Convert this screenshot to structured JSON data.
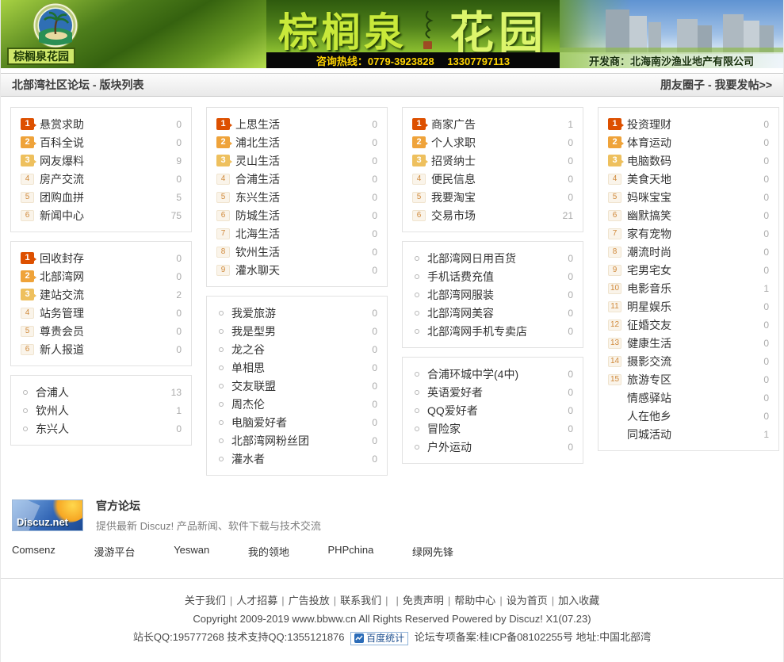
{
  "colors": {
    "banner_green_dark": "#2e5a0e",
    "banner_green_light": "#b8e34c",
    "rank1": "#dd5000",
    "rank2": "#efa33a",
    "rank3": "#eec05e",
    "rank_other_text": "#d08a3c",
    "count_gray": "#aaaaaa",
    "hotline_yellow": "#ffd400",
    "discuz_blue": "#2f64b4",
    "flame_orange": "#f6a623"
  },
  "banner": {
    "logo_label": "棕榈泉花园",
    "title_part1": "棕榈泉",
    "title_part2": "花园",
    "hotline": "咨询热线：0779-3923828　 13307797113",
    "developer": "开发商：北海南沙渔业地产有限公司"
  },
  "header": {
    "title": "北部湾社区论坛 - 版块列表",
    "right_links": [
      {
        "label": "朋友圈子"
      },
      {
        "label": "我要发帖>>"
      }
    ],
    "right_separator": " - "
  },
  "columns": [
    {
      "boxes": [
        {
          "items": [
            {
              "rank": "1",
              "label": "悬赏求助",
              "count": "0"
            },
            {
              "rank": "2",
              "label": "百科全说",
              "count": "0"
            },
            {
              "rank": "3",
              "label": "网友爆料",
              "count": "9"
            },
            {
              "rank": "4",
              "label": "房产交流",
              "count": "0"
            },
            {
              "rank": "5",
              "label": "团购血拼",
              "count": "5"
            },
            {
              "rank": "6",
              "label": "新闻中心",
              "count": "75"
            }
          ]
        },
        {
          "items": [
            {
              "rank": "1",
              "label": "回收封存",
              "count": "0"
            },
            {
              "rank": "2",
              "label": "北部湾网",
              "count": "0"
            },
            {
              "rank": "3",
              "label": "建站交流",
              "count": "2"
            },
            {
              "rank": "4",
              "label": "站务管理",
              "count": "0"
            },
            {
              "rank": "5",
              "label": "尊贵会员",
              "count": "0"
            },
            {
              "rank": "6",
              "label": "新人报道",
              "count": "0"
            }
          ]
        },
        {
          "items": [
            {
              "bullet": true,
              "label": "合浦人",
              "count": "13"
            },
            {
              "bullet": true,
              "label": "钦州人",
              "count": "1"
            },
            {
              "bullet": true,
              "label": "东兴人",
              "count": "0"
            }
          ]
        }
      ]
    },
    {
      "boxes": [
        {
          "items": [
            {
              "rank": "1",
              "label": "上思生活",
              "count": "0"
            },
            {
              "rank": "2",
              "label": "浦北生活",
              "count": "0"
            },
            {
              "rank": "3",
              "label": "灵山生活",
              "count": "0"
            },
            {
              "rank": "4",
              "label": "合浦生活",
              "count": "0"
            },
            {
              "rank": "5",
              "label": "东兴生活",
              "count": "0"
            },
            {
              "rank": "6",
              "label": "防城生活",
              "count": "0"
            },
            {
              "rank": "7",
              "label": "北海生活",
              "count": "0"
            },
            {
              "rank": "8",
              "label": "钦州生活",
              "count": "0"
            },
            {
              "rank": "9",
              "label": "灌水聊天",
              "count": "0"
            }
          ]
        },
        {
          "items": [
            {
              "bullet": true,
              "label": "我爱旅游",
              "count": "0"
            },
            {
              "bullet": true,
              "label": "我是型男",
              "count": "0"
            },
            {
              "bullet": true,
              "label": "龙之谷",
              "count": "0"
            },
            {
              "bullet": true,
              "label": "单相思",
              "count": "0"
            },
            {
              "bullet": true,
              "label": "交友联盟",
              "count": "0"
            },
            {
              "bullet": true,
              "label": "周杰伦",
              "count": "0"
            },
            {
              "bullet": true,
              "label": "电脑爱好者",
              "count": "0"
            },
            {
              "bullet": true,
              "label": "北部湾网粉丝团",
              "count": "0"
            },
            {
              "bullet": true,
              "label": "灌水者",
              "count": "0"
            }
          ]
        }
      ]
    },
    {
      "boxes": [
        {
          "items": [
            {
              "rank": "1",
              "label": "商家广告",
              "count": "1"
            },
            {
              "rank": "2",
              "label": "个人求职",
              "count": "0"
            },
            {
              "rank": "3",
              "label": "招贤纳士",
              "count": "0"
            },
            {
              "rank": "4",
              "label": "便民信息",
              "count": "0"
            },
            {
              "rank": "5",
              "label": "我要淘宝",
              "count": "0"
            },
            {
              "rank": "6",
              "label": "交易市场",
              "count": "21"
            }
          ]
        },
        {
          "items": [
            {
              "bullet": true,
              "label": "北部湾网日用百货",
              "count": "0"
            },
            {
              "bullet": true,
              "label": "手机话费充值",
              "count": "0"
            },
            {
              "bullet": true,
              "label": "北部湾网服装",
              "count": "0"
            },
            {
              "bullet": true,
              "label": "北部湾网美容",
              "count": "0"
            },
            {
              "bullet": true,
              "label": "北部湾网手机专卖店",
              "count": "0"
            }
          ]
        },
        {
          "items": [
            {
              "bullet": true,
              "label": "合浦环城中学(4中)",
              "count": "0"
            },
            {
              "bullet": true,
              "label": "英语爱好者",
              "count": "0"
            },
            {
              "bullet": true,
              "label": "QQ爱好者",
              "count": "0"
            },
            {
              "bullet": true,
              "label": "冒险家",
              "count": "0"
            },
            {
              "bullet": true,
              "label": "户外运动",
              "count": "0"
            }
          ]
        }
      ]
    },
    {
      "boxes": [
        {
          "items": [
            {
              "rank": "1",
              "label": "投资理财",
              "count": "0"
            },
            {
              "rank": "2",
              "label": "体育运动",
              "count": "0"
            },
            {
              "rank": "3",
              "label": "电脑数码",
              "count": "0"
            },
            {
              "rank": "4",
              "label": "美食天地",
              "count": "0"
            },
            {
              "rank": "5",
              "label": "妈咪宝宝",
              "count": "0"
            },
            {
              "rank": "6",
              "label": "幽默搞笑",
              "count": "0"
            },
            {
              "rank": "7",
              "label": "家有宠物",
              "count": "0"
            },
            {
              "rank": "8",
              "label": "潮流时尚",
              "count": "0"
            },
            {
              "rank": "9",
              "label": "宅男宅女",
              "count": "0"
            },
            {
              "rank": "10",
              "label": "电影音乐",
              "count": "1"
            },
            {
              "rank": "11",
              "label": "明星娱乐",
              "count": "0"
            },
            {
              "rank": "12",
              "label": "征婚交友",
              "count": "0"
            },
            {
              "rank": "13",
              "label": "健康生活",
              "count": "0"
            },
            {
              "rank": "14",
              "label": "摄影交流",
              "count": "0"
            },
            {
              "rank": "15",
              "label": "旅游专区",
              "count": "0"
            },
            {
              "rank": null,
              "label": "情感驿站",
              "count": "0"
            },
            {
              "rank": null,
              "label": "人在他乡",
              "count": "0"
            },
            {
              "rank": null,
              "label": "同城活动",
              "count": "1"
            }
          ]
        }
      ]
    }
  ],
  "footer": {
    "official": {
      "logo_text": "Discuz.net",
      "title": "官方论坛",
      "desc": "提供最新 Discuz! 产品新闻、软件下载与技术交流"
    },
    "partners": [
      {
        "label": "Comsenz"
      },
      {
        "label": "漫游平台"
      },
      {
        "label": "Yeswan"
      },
      {
        "label": "我的领地"
      },
      {
        "label": "PHPchina"
      },
      {
        "label": "绿网先锋"
      }
    ],
    "nav_links": [
      {
        "label": "关于我们"
      },
      {
        "label": "人才招募"
      },
      {
        "label": "广告投放"
      },
      {
        "label": "联系我们"
      },
      {
        "label": ""
      },
      {
        "label": "免责声明"
      },
      {
        "label": "帮助中心"
      },
      {
        "label": "设为首页"
      },
      {
        "label": "加入收藏"
      }
    ],
    "nav_separator": "|",
    "copyright": "Copyright 2009-2019 www.bbww.cn All Rights Reserved Powered by Discuz! X1(07.23)",
    "info_left": "站长QQ:195777268 技术支持QQ:1355121876",
    "baidu_badge": "百度统计",
    "info_right": "论坛专项备案:桂ICP备08102255号 地址:中国北部湾"
  }
}
